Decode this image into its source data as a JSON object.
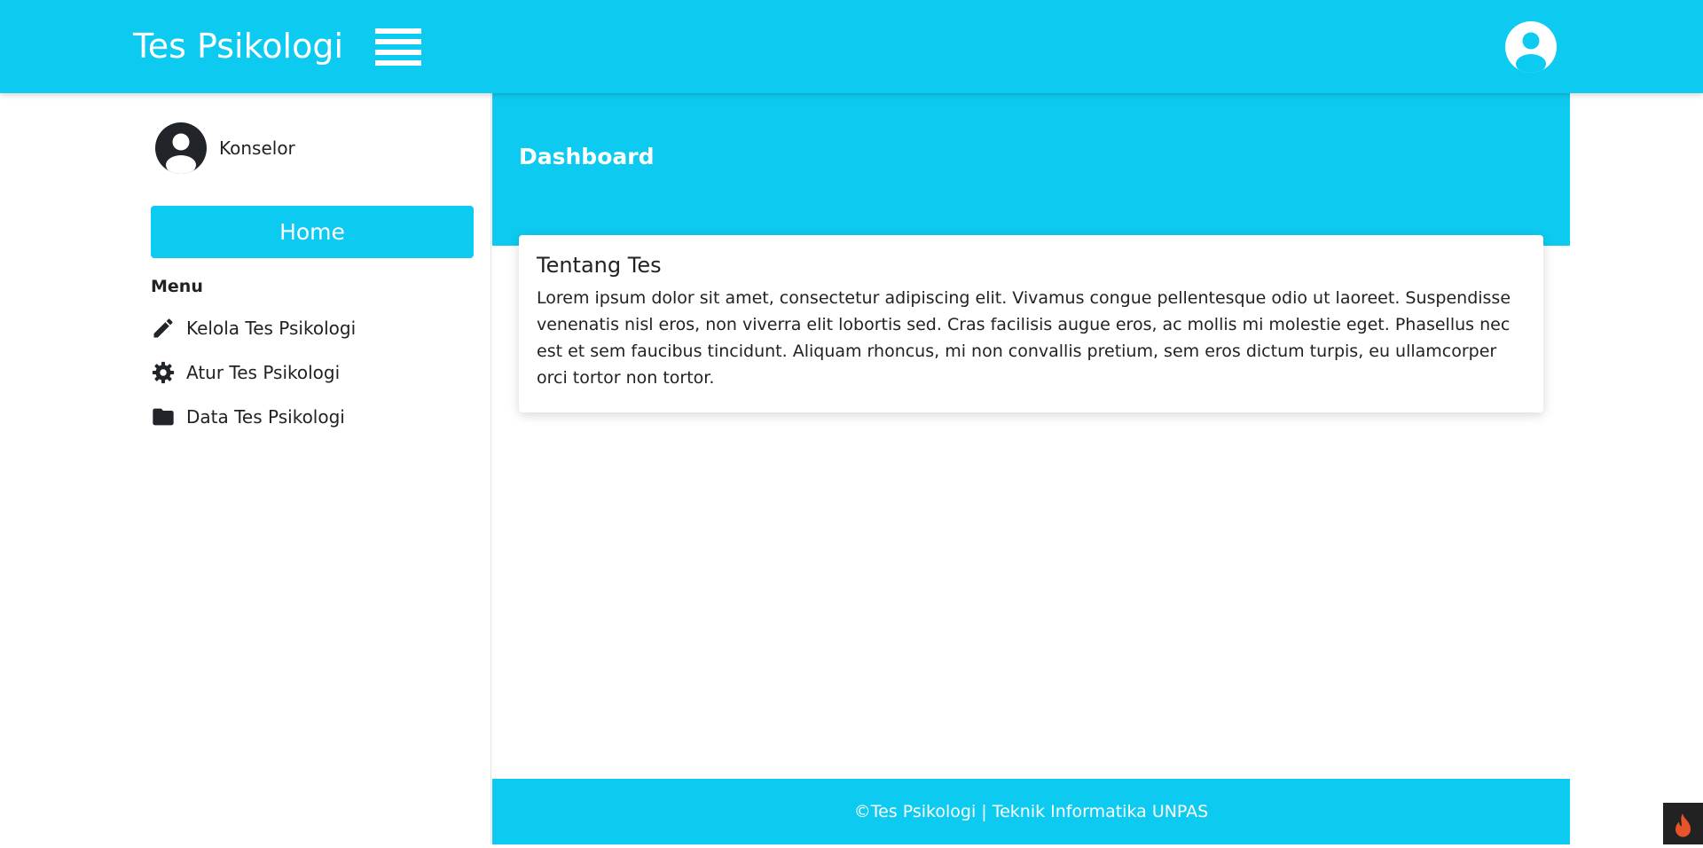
{
  "brand": "Tes Psikologi",
  "profile": {
    "name": "Konselor"
  },
  "sidebar": {
    "home_label": "Home",
    "menu_heading": "Menu",
    "items": [
      {
        "label": "Kelola Tes Psikologi",
        "icon": "pencil-icon"
      },
      {
        "label": "Atur Tes Psikologi",
        "icon": "gear-icon"
      },
      {
        "label": "Data Tes Psikologi",
        "icon": "folder-icon"
      }
    ]
  },
  "main": {
    "title": "Dashboard",
    "card": {
      "title": "Tentang Tes",
      "text": "Lorem ipsum dolor sit amet, consectetur adipiscing elit. Vivamus congue pellentesque odio ut laoreet. Suspendisse venenatis nisl eros, non viverra elit lobortis sed. Cras facilisis augue eros, ac mollis mi molestie eget. Phasellus nec est et sem faucibus tincidunt. Aliquam rhoncus, mi non convallis pretium, sem eros dictum turpis, eu ullamcorper orci tortor non tortor."
    }
  },
  "footer": {
    "text": "©Tes Psikologi | Teknik Informatika UNPAS"
  },
  "colors": {
    "accent": "#0dcaf0",
    "text": "#212529",
    "toolbar_flame": "#e8542a"
  }
}
